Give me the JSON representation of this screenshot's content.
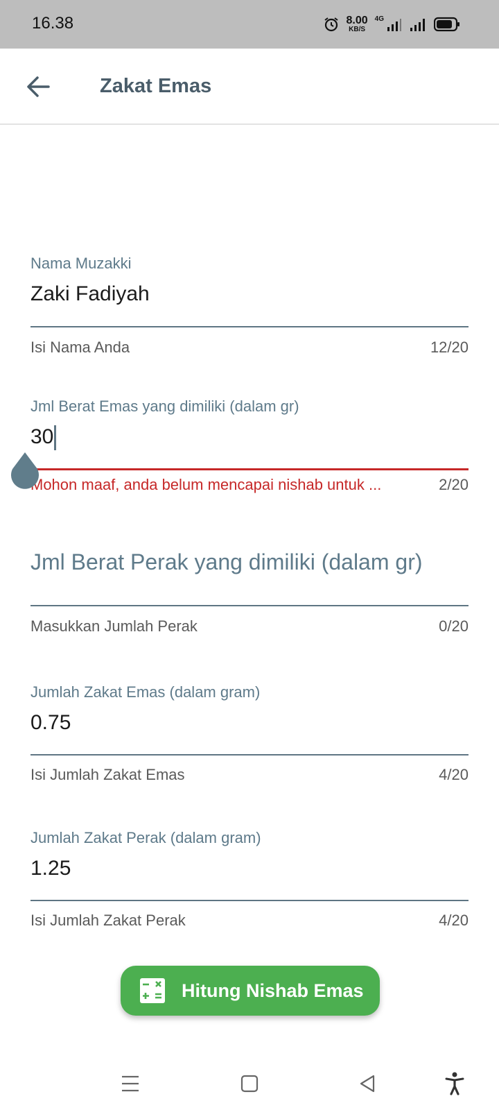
{
  "status_bar": {
    "time": "16.38",
    "speed_value": "8.00",
    "speed_unit": "KB/S",
    "network": "4G"
  },
  "app_bar": {
    "title": "Zakat Emas",
    "back_icon": "arrow-left-icon"
  },
  "form": {
    "nama": {
      "label": "Nama Muzakki",
      "value": "Zaki Fadiyah",
      "helper": "Isi Nama Anda",
      "counter": "12/20"
    },
    "emas": {
      "label": "Jml Berat Emas yang dimiliki (dalam gr)",
      "value": "30",
      "error": "Mohon maaf, anda belum mencapai nishab untuk ...",
      "counter": "2/20"
    },
    "perak": {
      "placeholder": "Jml Berat Perak yang dimiliki (dalam gr)",
      "helper": "Masukkan Jumlah Perak",
      "counter": "0/20"
    },
    "zakat_emas": {
      "label": "Jumlah Zakat Emas (dalam gram)",
      "value": "0.75",
      "helper": "Isi Jumlah Zakat Emas",
      "counter": "4/20"
    },
    "zakat_perak": {
      "label": "Jumlah Zakat Perak (dalam gram)",
      "value": "1.25",
      "helper": "Isi Jumlah Zakat Perak",
      "counter": "4/20"
    }
  },
  "button": {
    "label": "Hitung Nishab Emas",
    "icon": "calculator-icon"
  },
  "colors": {
    "accent": "#5e7a8a",
    "error": "#c62828",
    "button": "#4caf50",
    "status_bar": "#bdbdbd"
  }
}
